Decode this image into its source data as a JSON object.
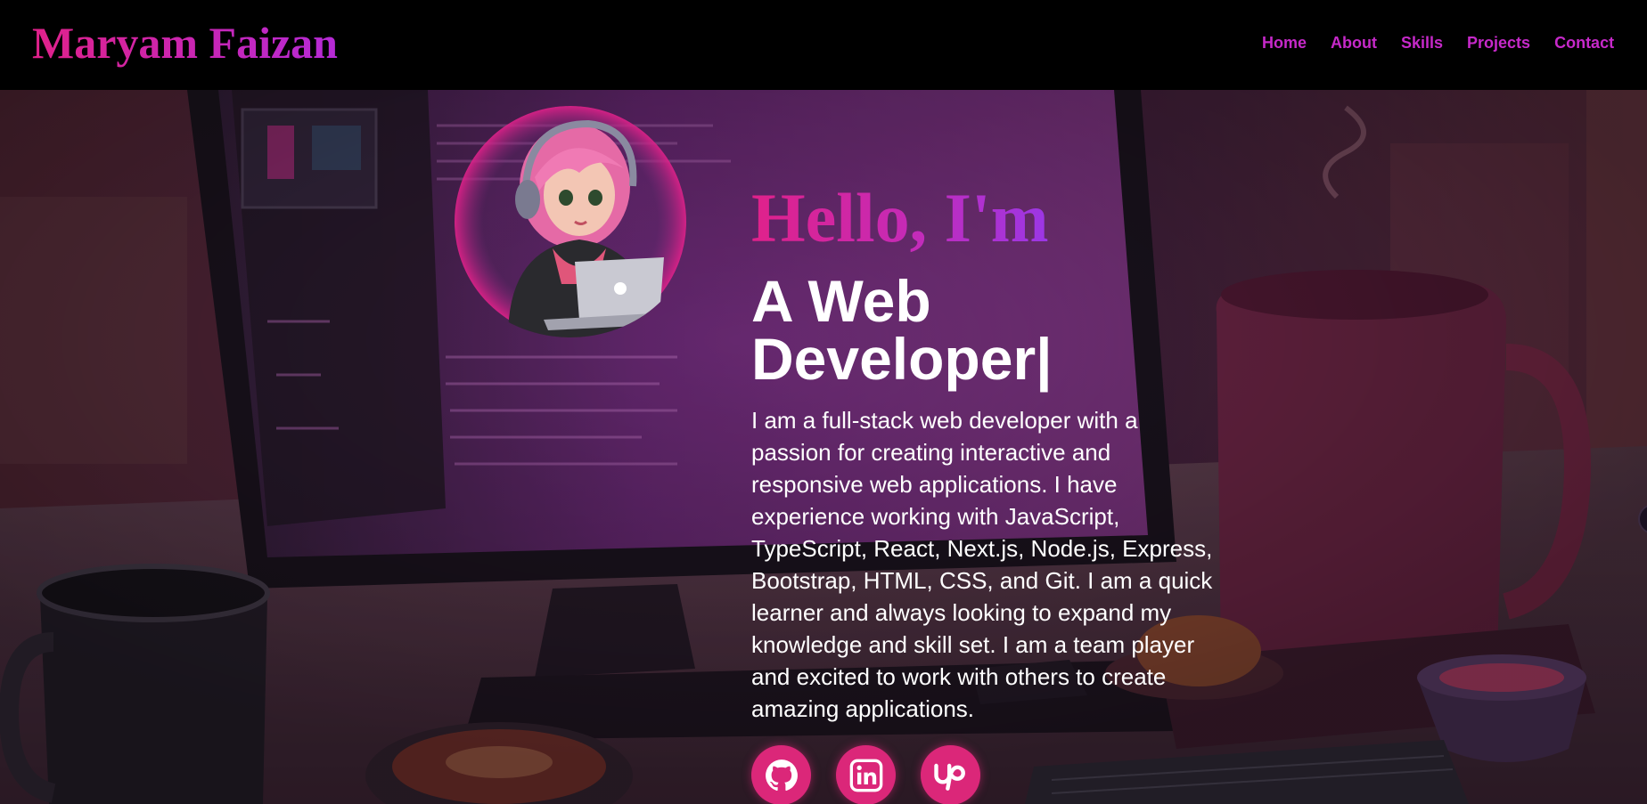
{
  "header": {
    "brand": "Maryam Faizan",
    "nav": [
      {
        "label": "Home"
      },
      {
        "label": "About"
      },
      {
        "label": "Skills"
      },
      {
        "label": "Projects"
      },
      {
        "label": "Contact"
      }
    ]
  },
  "hero": {
    "greeting": "Hello, I'm",
    "role": "A Web Developer",
    "cursor": "|",
    "bio": "I am a full-stack web developer with a passion for creating interactive and responsive web applications. I have experience working with JavaScript, TypeScript, React, Next.js, Node.js, Express, Bootstrap, HTML, CSS, and Git. I am a quick learner and always looking to expand my knowledge and skill set. I am a team player and excited to work with others to create amazing applications.",
    "avatar_icon": "girl-with-laptop-illustration",
    "background_icon": "desk-computer-illustration",
    "socials": [
      {
        "icon": "github-icon"
      },
      {
        "icon": "linkedin-icon"
      },
      {
        "icon": "upwork-icon"
      }
    ]
  },
  "colors": {
    "brand_gradient_start": "#e0218a",
    "brand_gradient_end": "#9b37e6",
    "nav_link": "#c629c9",
    "social_button": "#db2779",
    "header_bg": "#000000"
  }
}
